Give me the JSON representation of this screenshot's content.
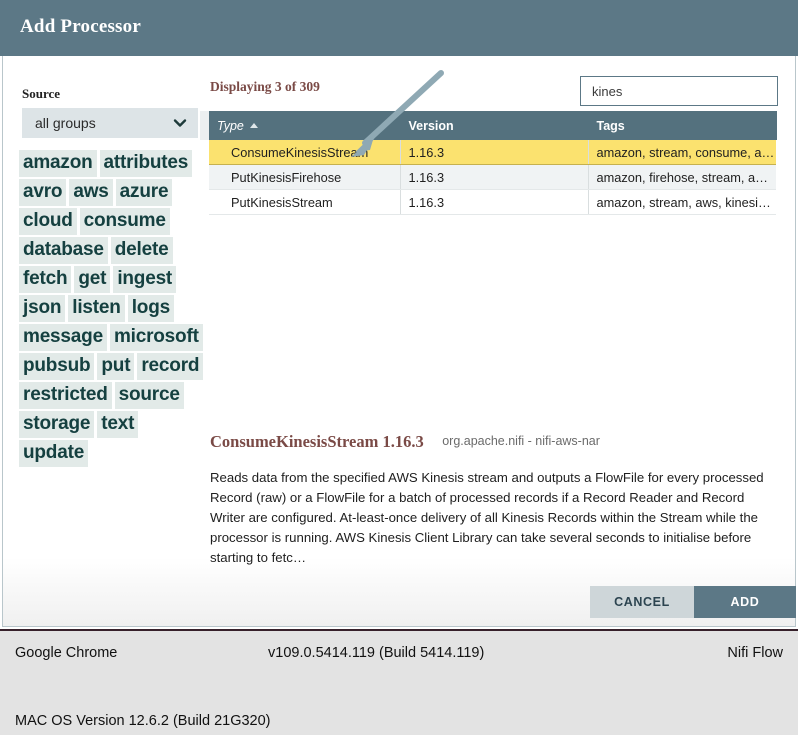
{
  "dialog": {
    "title": "Add Processor"
  },
  "source": {
    "label": "Source",
    "selected": "all groups",
    "chevron_icon": "chevron-down-icon"
  },
  "tags": [
    "amazon",
    "attributes",
    "avro",
    "aws",
    "azure",
    "cloud",
    "consume",
    "database",
    "delete",
    "fetch",
    "get",
    "ingest",
    "json",
    "listen",
    "logs",
    "message",
    "microsoft",
    "pubsub",
    "put",
    "record",
    "restricted",
    "source",
    "storage",
    "text",
    "update"
  ],
  "results": {
    "displaying": "Displaying 3 of 309",
    "filter": {
      "value": "kines",
      "placeholder": ""
    },
    "columns": [
      "Type",
      "Version",
      "Tags"
    ],
    "sort_column": "Type",
    "sort_direction": "asc",
    "rows": [
      {
        "type": "ConsumeKinesisStream",
        "version": "1.16.3",
        "tags": "amazon, stream, consume, aws…",
        "selected": true
      },
      {
        "type": "PutKinesisFirehose",
        "version": "1.16.3",
        "tags": "amazon, firehose, stream, aws, …",
        "selected": false
      },
      {
        "type": "PutKinesisStream",
        "version": "1.16.3",
        "tags": "amazon, stream, aws, kinesis, p…",
        "selected": false
      }
    ]
  },
  "detail": {
    "title": "ConsumeKinesisStream 1.16.3",
    "bundle": "org.apache.nifi - nifi-aws-nar",
    "description": "Reads data from the specified AWS Kinesis stream and outputs a FlowFile for every processed Record (raw) or a FlowFile for a batch of processed records if a Record Reader and Record Writer are configured. At-least-once delivery of all Kinesis Records within the Stream while the processor is running. AWS Kinesis Client Library can take several seconds to initialise before starting to fetc…"
  },
  "footer": {
    "cancel_label": "CANCEL",
    "add_label": "ADD"
  },
  "infobar": {
    "browser": "Google Chrome",
    "browser_version": "v109.0.5414.119 (Build 5414.119)",
    "app": "Nifi Flow",
    "os": "MAC OS Version 12.6.2 (Build 21G320)"
  },
  "annotation": {
    "arrow_icon": "arrow-pointer",
    "color": "#8fa9b4"
  },
  "colors": {
    "header": "#5c7886",
    "table_header": "#54717e",
    "selected_row": "#fbe26f",
    "accent_text": "#7a4a46",
    "tag_bg": "#e2eae8",
    "tag_text": "#154040"
  }
}
